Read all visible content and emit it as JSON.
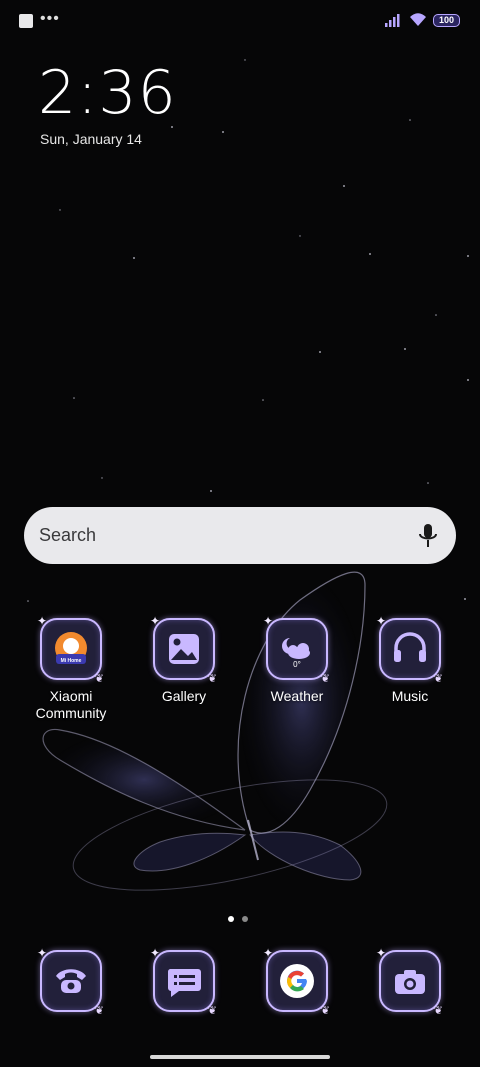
{
  "status_bar": {
    "battery_level": "100",
    "signal_icon": "signal-icon",
    "wifi_icon": "wifi-icon"
  },
  "lock": {
    "time": "2:36",
    "date": "Sun, January 14"
  },
  "search": {
    "placeholder": "Search",
    "mic_icon": "microphone-icon"
  },
  "apps": [
    {
      "label": "Xiaomi\nCommunity",
      "icon": "xiaomi-community-icon",
      "badge_text": "Mi Home"
    },
    {
      "label": "Gallery",
      "icon": "gallery-icon"
    },
    {
      "label": "Weather",
      "icon": "weather-icon",
      "temperature": "0°"
    },
    {
      "label": "Music",
      "icon": "headphones-icon"
    }
  ],
  "dock": [
    {
      "icon": "phone-icon"
    },
    {
      "icon": "messages-icon"
    },
    {
      "icon": "google-icon"
    },
    {
      "icon": "camera-icon"
    }
  ],
  "page_indicator": {
    "pages": 2,
    "active": 1
  },
  "colors": {
    "accent": "#c9b8ff",
    "icon_bg": "#22203a",
    "search_bg": "#e9e9ec",
    "background": "#060607"
  }
}
